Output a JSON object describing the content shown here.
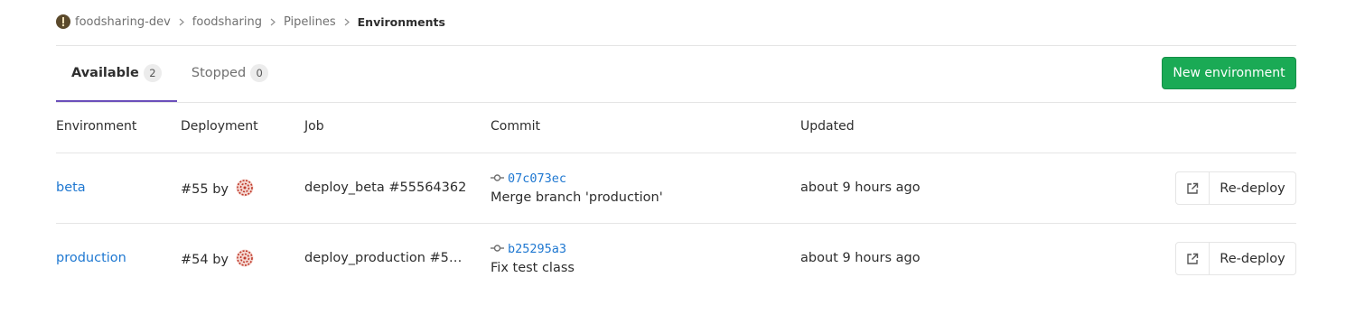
{
  "breadcrumb": {
    "items": [
      "foodsharing-dev",
      "foodsharing",
      "Pipelines"
    ],
    "current": "Environments"
  },
  "tabs": [
    {
      "label": "Available",
      "count": "2",
      "active": true
    },
    {
      "label": "Stopped",
      "count": "0",
      "active": false
    }
  ],
  "new_environment_label": "New environment",
  "table": {
    "headers": [
      "Environment",
      "Deployment",
      "Job",
      "Commit",
      "Updated"
    ],
    "rows": [
      {
        "environment": "beta",
        "deployment": "#55 by",
        "job": "deploy_beta #55564362",
        "commit_sha": "07c073ec",
        "commit_title": "Merge branch 'production'",
        "updated": "about 9 hours ago",
        "redeploy_label": "Re-deploy"
      },
      {
        "environment": "production",
        "deployment": "#54 by",
        "job": "deploy_production #55…",
        "commit_sha": "b25295a3",
        "commit_title": "Fix test class",
        "updated": "about 9 hours ago",
        "redeploy_label": "Re-deploy"
      }
    ]
  },
  "colors": {
    "accent_tab": "#6b4fbb",
    "primary_green": "#1aaa55",
    "link": "#1f78d1"
  }
}
